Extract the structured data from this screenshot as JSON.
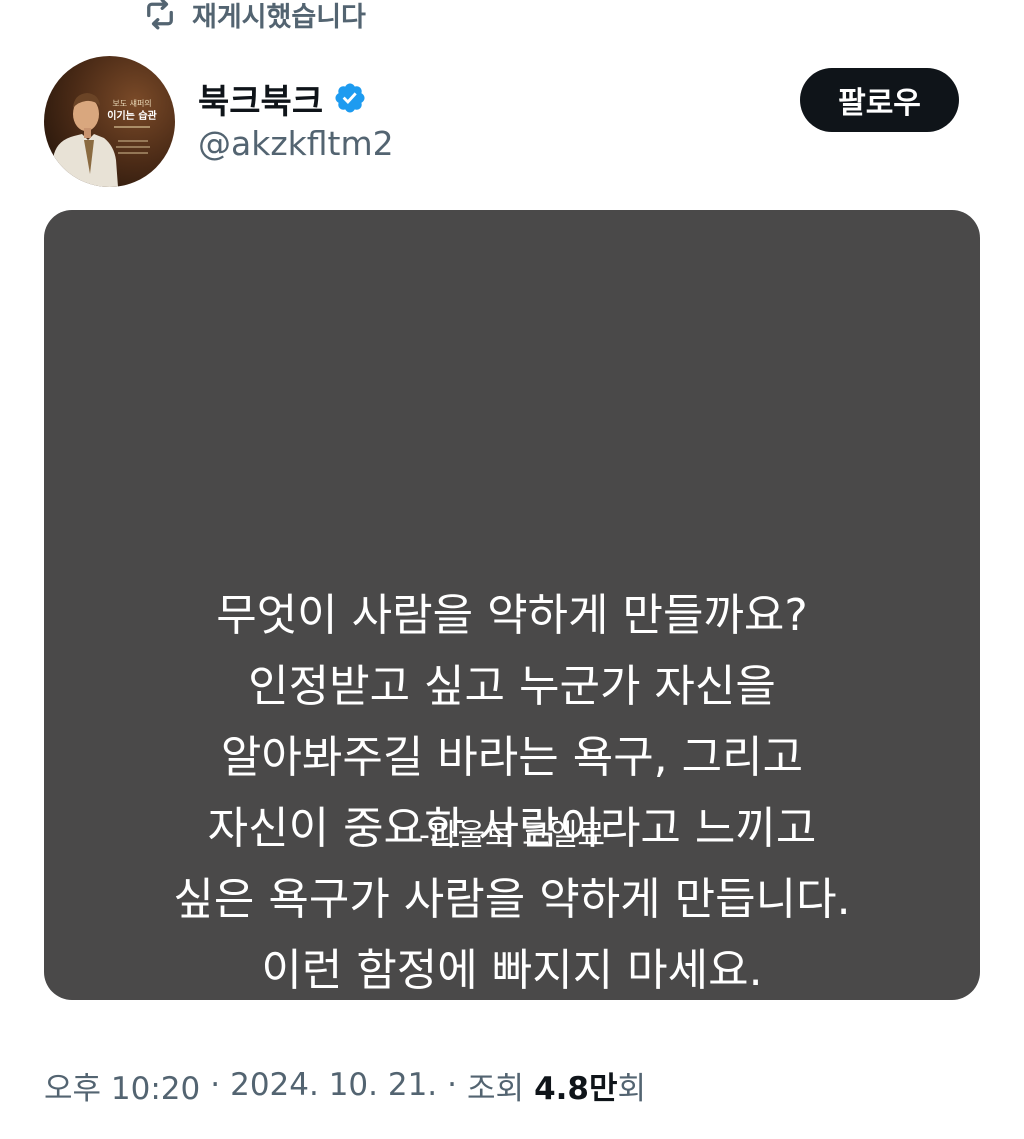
{
  "repost": {
    "label": "재게시했습니다",
    "icon": "repost-icon"
  },
  "author": {
    "display_name": "북크북크",
    "handle": "@akzkfltm2",
    "verified": true,
    "avatar_icon": "book-cover-avatar",
    "avatar_text": {
      "line1": "보도 섀퍼의",
      "line2": "이기는 습관"
    }
  },
  "follow_button": {
    "label": "팔로우"
  },
  "media": {
    "quote_lines": [
      "무엇이 사람을 약하게 만들까요?",
      "인정받고 싶고 누군가 자신을",
      "알아봐주길 바라는 욕구, 그리고",
      "자신이 중요한 사람이라고 느끼고",
      "싶은 욕구가 사람을 약하게 만듭니다.",
      "이런 함정에 빠지지 마세요."
    ],
    "quote_author": "-파울로 코엘료"
  },
  "meta": {
    "time": "오후 10:20",
    "separator": "·",
    "date": "2024. 10. 21.",
    "views_label": "조회",
    "views_count": "4.8만",
    "views_unit": "회"
  },
  "colors": {
    "text_primary": "#0f1419",
    "text_secondary": "#536471",
    "verified_blue": "#1d9bf0",
    "card_background": "#4a4949",
    "button_background": "#0f1419"
  }
}
